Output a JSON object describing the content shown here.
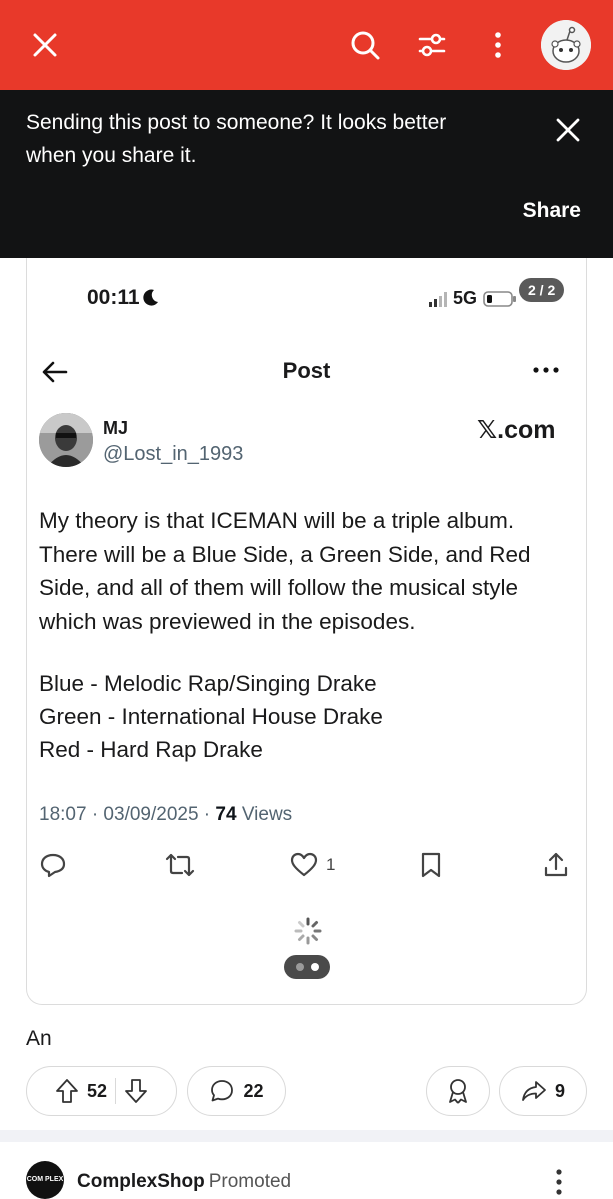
{
  "topbar": {
    "close_icon": "close-icon",
    "search_icon": "search-icon",
    "filter_icon": "filter-icon",
    "more_icon": "more-vertical-icon",
    "avatar_icon": "reddit-snoo-avatar",
    "color": "#e8392a"
  },
  "share_banner": {
    "message": "Sending this post to someone? It looks better when you share it.",
    "share_label": "Share"
  },
  "screenshot": {
    "status_time": "00:11",
    "network": "5G",
    "page_indicator": "2 / 2",
    "header_title": "Post",
    "author_name": "MJ",
    "author_handle": "@Lost_in_1993",
    "brand": "𝕏.com",
    "body_lines": [
      "My theory is that ICEMAN will be a triple album.",
      "There will be a Blue Side, a Green Side, and Red",
      "Side, and all of them will follow the musical style",
      "which was previewed in the episodes."
    ],
    "list_lines": [
      "Blue - Melodic Rap/Singing Drake",
      "Green - International House Drake",
      "Red - Hard Rap Drake"
    ],
    "timestamp": "18:07 · 03/09/2025 · ",
    "views_count": "74",
    "views_label": " Views",
    "likes": "1"
  },
  "post": {
    "title_snippet": "An",
    "upvotes": "52",
    "comments": "22",
    "shares": "9"
  },
  "promo": {
    "logo_text": "COM PLEX",
    "name": "ComplexShop",
    "tag": "Promoted"
  }
}
